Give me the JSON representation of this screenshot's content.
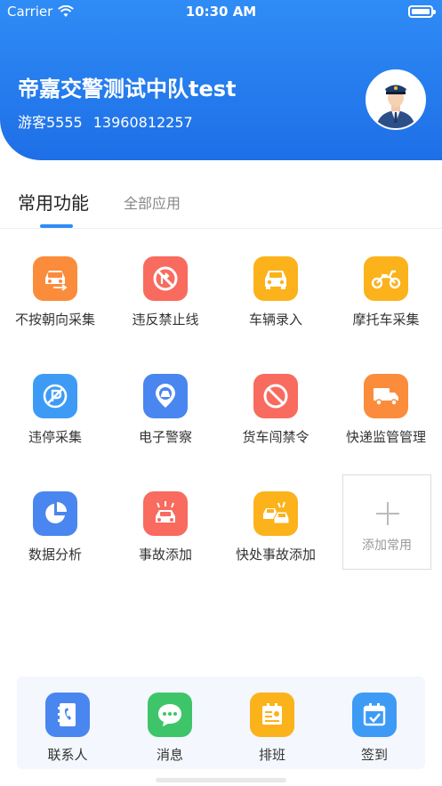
{
  "status_bar": {
    "carrier": "Carrier",
    "time": "10:30 AM"
  },
  "header": {
    "unit_name": "帝嘉交警测试中队test",
    "user_role": "游客5555",
    "phone": "13960812257"
  },
  "tabs": {
    "active": "常用功能",
    "inactive": "全部应用"
  },
  "functions": [
    {
      "label": "不按朝向采集",
      "icon": "car-direction-icon",
      "color": "#fb8c3c"
    },
    {
      "label": "违反禁止线",
      "icon": "no-turn-sign-icon",
      "color": "#f86b5e"
    },
    {
      "label": "车辆录入",
      "icon": "car-front-icon",
      "color": "#fbb21b"
    },
    {
      "label": "摩托车采集",
      "icon": "motorcycle-icon",
      "color": "#fbb21b"
    },
    {
      "label": "违停采集",
      "icon": "no-parking-icon",
      "color": "#3d9bf6"
    },
    {
      "label": "电子警察",
      "icon": "traffic-camera-icon",
      "color": "#4a86ef"
    },
    {
      "label": "货车闯禁令",
      "icon": "prohibited-sign-icon",
      "color": "#f86b5e"
    },
    {
      "label": "快递监管管理",
      "icon": "delivery-truck-icon",
      "color": "#fb8c3c"
    },
    {
      "label": "数据分析",
      "icon": "pie-chart-icon",
      "color": "#4a86ef"
    },
    {
      "label": "事故添加",
      "icon": "car-crash-icon",
      "color": "#f86b5e"
    },
    {
      "label": "快处事故添加",
      "icon": "fast-accident-icon",
      "color": "#fbb21b"
    }
  ],
  "add_common": {
    "label": "添加常用"
  },
  "bottom_bar": [
    {
      "label": "联系人",
      "icon": "contacts-icon",
      "color": "#4a86ef"
    },
    {
      "label": "消息",
      "icon": "message-icon",
      "color": "#3ec56a"
    },
    {
      "label": "排班",
      "icon": "schedule-icon",
      "color": "#fbb21b"
    },
    {
      "label": "签到",
      "icon": "checkin-calendar-icon",
      "color": "#3d9bf6"
    }
  ]
}
